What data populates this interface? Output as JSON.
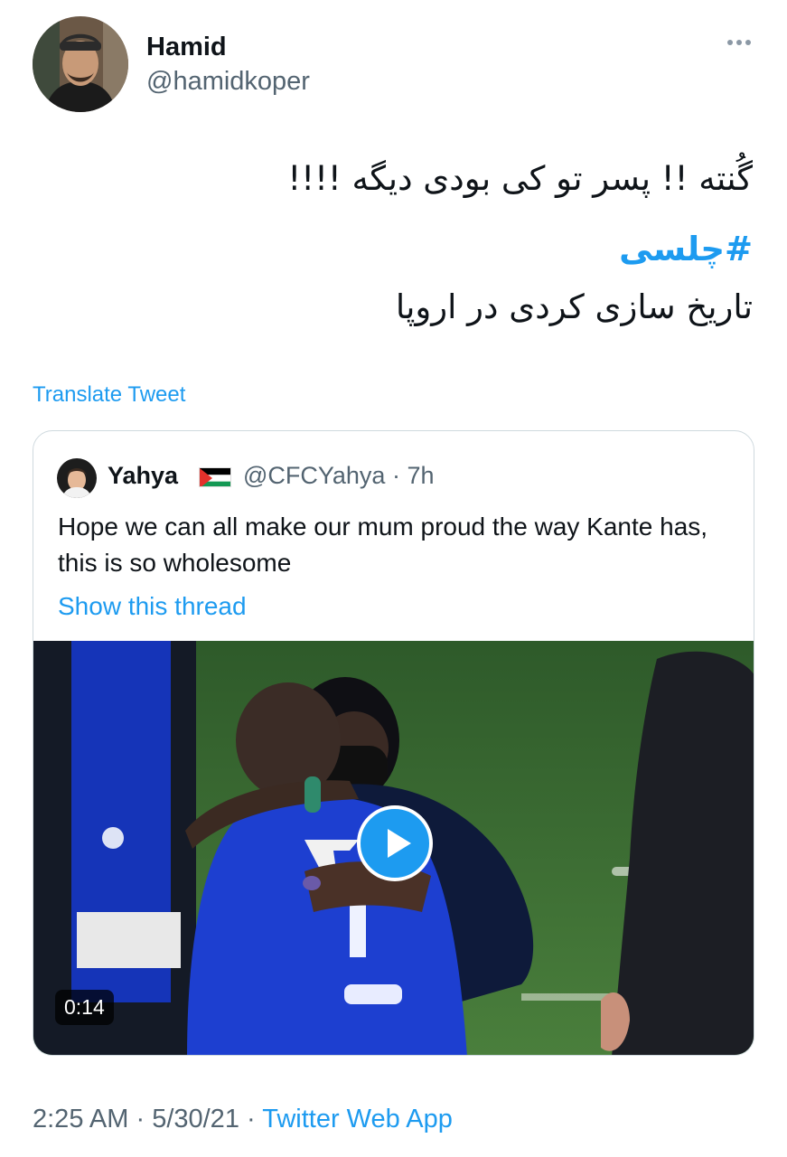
{
  "author": {
    "display_name": "Hamid",
    "handle": "@hamidkoper"
  },
  "tweet": {
    "line1": "گُنته !! پسر تو کی بودی دیگه !!!!",
    "hashtag": "#چلسی",
    "line3": "تاریخ سازی کردی در اروپا"
  },
  "translate_label": "Translate Tweet",
  "quoted": {
    "display_name": "Yahya",
    "meta": "@CFCYahya · 7h",
    "text": "Hope we can all make our mum proud the way Kante has, this is so wholesome",
    "thread_link": "Show this thread",
    "video_duration": "0:14"
  },
  "footer": {
    "time": "2:25 AM",
    "date": "5/30/21",
    "separator": " · ",
    "source": "Twitter Web App"
  },
  "colors": {
    "link": "#1d9bf0",
    "secondary_text": "#536471",
    "border": "#cfd9de"
  },
  "icons": [
    "more-icon",
    "play-icon",
    "palestine-flag-icon"
  ]
}
